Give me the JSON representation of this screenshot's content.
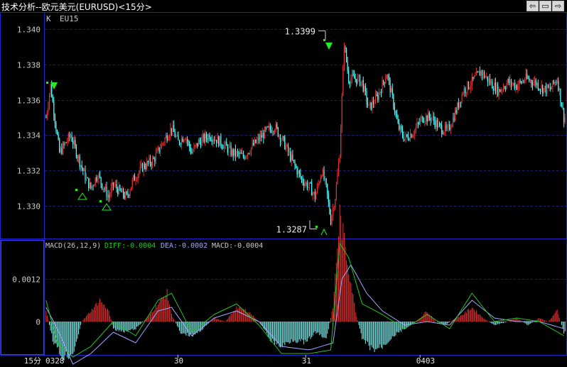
{
  "window": {
    "title": "技术分析--欧元美元(EURUSD)<15分>",
    "buttons": [
      {
        "name": "prev-window-button",
        "glyph": "⇦"
      },
      {
        "name": "restore-window-button",
        "glyph": "▭"
      },
      {
        "name": "next-window-button",
        "glyph": "⇨"
      }
    ]
  },
  "chart_data": [
    {
      "type": "candlestick",
      "panel": "price",
      "indicator_label": "K",
      "symbol_label": "EU15",
      "y_ticks": [
        "1.340",
        "1.338",
        "1.336",
        "1.334",
        "1.332",
        "1.330"
      ],
      "ylim": [
        1.3287,
        1.3399
      ],
      "high_marker": {
        "label": "1.3399",
        "value": 1.3399
      },
      "low_marker": {
        "label": "1.3287",
        "value": 1.3287
      },
      "up_color": "#e03030",
      "down_color": "#54ffff",
      "path": [
        [
          0,
          1.335
        ],
        [
          4,
          1.3368
        ],
        [
          12,
          1.333
        ],
        [
          22,
          1.334
        ],
        [
          30,
          1.3325
        ],
        [
          36,
          1.3315
        ],
        [
          40,
          1.331
        ],
        [
          46,
          1.3318
        ],
        [
          50,
          1.3312
        ],
        [
          56,
          1.3305
        ],
        [
          60,
          1.3312
        ],
        [
          66,
          1.3308
        ],
        [
          72,
          1.3305
        ],
        [
          78,
          1.3315
        ],
        [
          86,
          1.3322
        ],
        [
          96,
          1.3326
        ],
        [
          106,
          1.3338
        ],
        [
          112,
          1.3344
        ],
        [
          118,
          1.3336
        ],
        [
          124,
          1.334
        ],
        [
          130,
          1.333
        ],
        [
          136,
          1.3336
        ],
        [
          146,
          1.334
        ],
        [
          156,
          1.3336
        ],
        [
          166,
          1.333
        ],
        [
          176,
          1.3328
        ],
        [
          186,
          1.3335
        ],
        [
          196,
          1.3342
        ],
        [
          204,
          1.3345
        ],
        [
          212,
          1.3336
        ],
        [
          220,
          1.3325
        ],
        [
          228,
          1.3315
        ],
        [
          236,
          1.331
        ],
        [
          240,
          1.3305
        ],
        [
          246,
          1.332
        ],
        [
          250,
          1.331
        ],
        [
          254,
          1.3292
        ],
        [
          258,
          1.3305
        ],
        [
          262,
          1.333
        ],
        [
          266,
          1.3392
        ],
        [
          270,
          1.3372
        ],
        [
          276,
          1.3372
        ],
        [
          282,
          1.337
        ],
        [
          288,
          1.3355
        ],
        [
          296,
          1.3362
        ],
        [
          304,
          1.3375
        ],
        [
          310,
          1.3358
        ],
        [
          314,
          1.3345
        ],
        [
          320,
          1.3338
        ],
        [
          328,
          1.3342
        ],
        [
          336,
          1.335
        ],
        [
          344,
          1.335
        ],
        [
          350,
          1.3345
        ],
        [
          358,
          1.3342
        ],
        [
          366,
          1.3354
        ],
        [
          372,
          1.3365
        ],
        [
          380,
          1.337
        ],
        [
          388,
          1.3376
        ],
        [
          396,
          1.337
        ],
        [
          404,
          1.3365
        ],
        [
          412,
          1.337
        ],
        [
          420,
          1.3368
        ],
        [
          428,
          1.3372
        ],
        [
          436,
          1.337
        ],
        [
          444,
          1.3366
        ],
        [
          450,
          1.3366
        ],
        [
          456,
          1.3372
        ],
        [
          462,
          1.335
        ]
      ],
      "jitter": 0.0006
    },
    {
      "type": "macd",
      "panel": "indicator",
      "label": "MACD(26,12,9)",
      "diff_label": "DIFF:-0.0004",
      "dea_label": "DEA:-0.0002",
      "macd_label": "MACD:-0.0004",
      "diff_color": "#22c522",
      "dea_color": "#a0a8ff",
      "y_ticks": [
        "0.0012",
        "0"
      ],
      "ylim": [
        -0.0013,
        0.0037
      ],
      "hist_path": [
        [
          0,
          0.0003
        ],
        [
          6,
          -0.0005
        ],
        [
          14,
          -0.001
        ],
        [
          24,
          -0.0009
        ],
        [
          32,
          0.0
        ],
        [
          40,
          0.0003
        ],
        [
          48,
          0.0006
        ],
        [
          56,
          0.0003
        ],
        [
          60,
          -0.0002
        ],
        [
          70,
          -0.0003
        ],
        [
          80,
          -0.0002
        ],
        [
          90,
          0.0001
        ],
        [
          100,
          0.0005
        ],
        [
          108,
          0.0008
        ],
        [
          112,
          0.0002
        ],
        [
          120,
          -0.0003
        ],
        [
          130,
          -0.0004
        ],
        [
          140,
          -0.0002
        ],
        [
          150,
          0.0001
        ],
        [
          160,
          0.0
        ],
        [
          170,
          0.0004
        ],
        [
          180,
          0.0003
        ],
        [
          190,
          0.0
        ],
        [
          200,
          -0.0005
        ],
        [
          210,
          -0.0007
        ],
        [
          220,
          -0.0005
        ],
        [
          232,
          -0.0006
        ],
        [
          240,
          -0.0003
        ],
        [
          250,
          -0.0005
        ],
        [
          256,
          0.0004
        ],
        [
          262,
          0.003
        ],
        [
          270,
          0.0015
        ],
        [
          276,
          0.0003
        ],
        [
          282,
          -0.0005
        ],
        [
          292,
          -0.0008
        ],
        [
          300,
          -0.0007
        ],
        [
          310,
          -0.0004
        ],
        [
          320,
          -0.0002
        ],
        [
          330,
          0.0
        ],
        [
          340,
          0.0003
        ],
        [
          348,
          0.0
        ],
        [
          356,
          -0.0001
        ],
        [
          366,
          0.0001
        ],
        [
          372,
          0.0002
        ],
        [
          380,
          0.0004
        ],
        [
          390,
          0.0001
        ],
        [
          400,
          -0.0001
        ],
        [
          412,
          0.0
        ],
        [
          420,
          0.0001
        ],
        [
          430,
          -0.0001
        ],
        [
          440,
          0.0001
        ],
        [
          448,
          0.0
        ],
        [
          456,
          0.0003
        ],
        [
          462,
          -0.0003
        ]
      ],
      "dea_path": [
        [
          0,
          0.0004
        ],
        [
          10,
          -0.0002
        ],
        [
          24,
          -0.0012
        ],
        [
          40,
          -0.0009
        ],
        [
          60,
          -0.0003
        ],
        [
          80,
          -0.0006
        ],
        [
          100,
          0.0003
        ],
        [
          112,
          0.0004
        ],
        [
          130,
          -0.0004
        ],
        [
          150,
          0.0001
        ],
        [
          170,
          0.0003
        ],
        [
          190,
          0.0
        ],
        [
          210,
          -0.0007
        ],
        [
          235,
          -0.0008
        ],
        [
          256,
          -0.0006
        ],
        [
          264,
          0.0012
        ],
        [
          272,
          0.0016
        ],
        [
          286,
          0.0008
        ],
        [
          300,
          0.0003
        ],
        [
          320,
          -0.0001
        ],
        [
          340,
          0.0
        ],
        [
          360,
          -0.0001
        ],
        [
          380,
          0.0006
        ],
        [
          400,
          0.0001
        ],
        [
          420,
          0.0
        ],
        [
          440,
          0.0
        ],
        [
          462,
          -0.0002
        ]
      ],
      "diff_path": [
        [
          0,
          0.0006
        ],
        [
          10,
          -0.0006
        ],
        [
          24,
          -0.001
        ],
        [
          40,
          -0.0007
        ],
        [
          60,
          0.0
        ],
        [
          80,
          -0.0004
        ],
        [
          100,
          0.0006
        ],
        [
          112,
          0.0008
        ],
        [
          130,
          -0.0003
        ],
        [
          150,
          0.0002
        ],
        [
          170,
          0.0005
        ],
        [
          190,
          -0.0001
        ],
        [
          210,
          -0.0009
        ],
        [
          235,
          -0.0009
        ],
        [
          254,
          -0.0008
        ],
        [
          262,
          0.0022
        ],
        [
          270,
          0.0018
        ],
        [
          282,
          0.0005
        ],
        [
          300,
          0.0002
        ],
        [
          320,
          -0.0002
        ],
        [
          340,
          0.0002
        ],
        [
          360,
          -0.0002
        ],
        [
          380,
          0.0008
        ],
        [
          400,
          0.0
        ],
        [
          420,
          0.0001
        ],
        [
          440,
          0.0
        ],
        [
          462,
          -0.0004
        ]
      ]
    }
  ],
  "x_axis": {
    "period_label": "15分",
    "labels": [
      {
        "text": "0328",
        "bar": 0
      },
      {
        "text": "30",
        "bar": 118
      },
      {
        "text": "31",
        "bar": 232
      },
      {
        "text": "0403",
        "bar": 334
      }
    ],
    "bar_count": 464
  }
}
